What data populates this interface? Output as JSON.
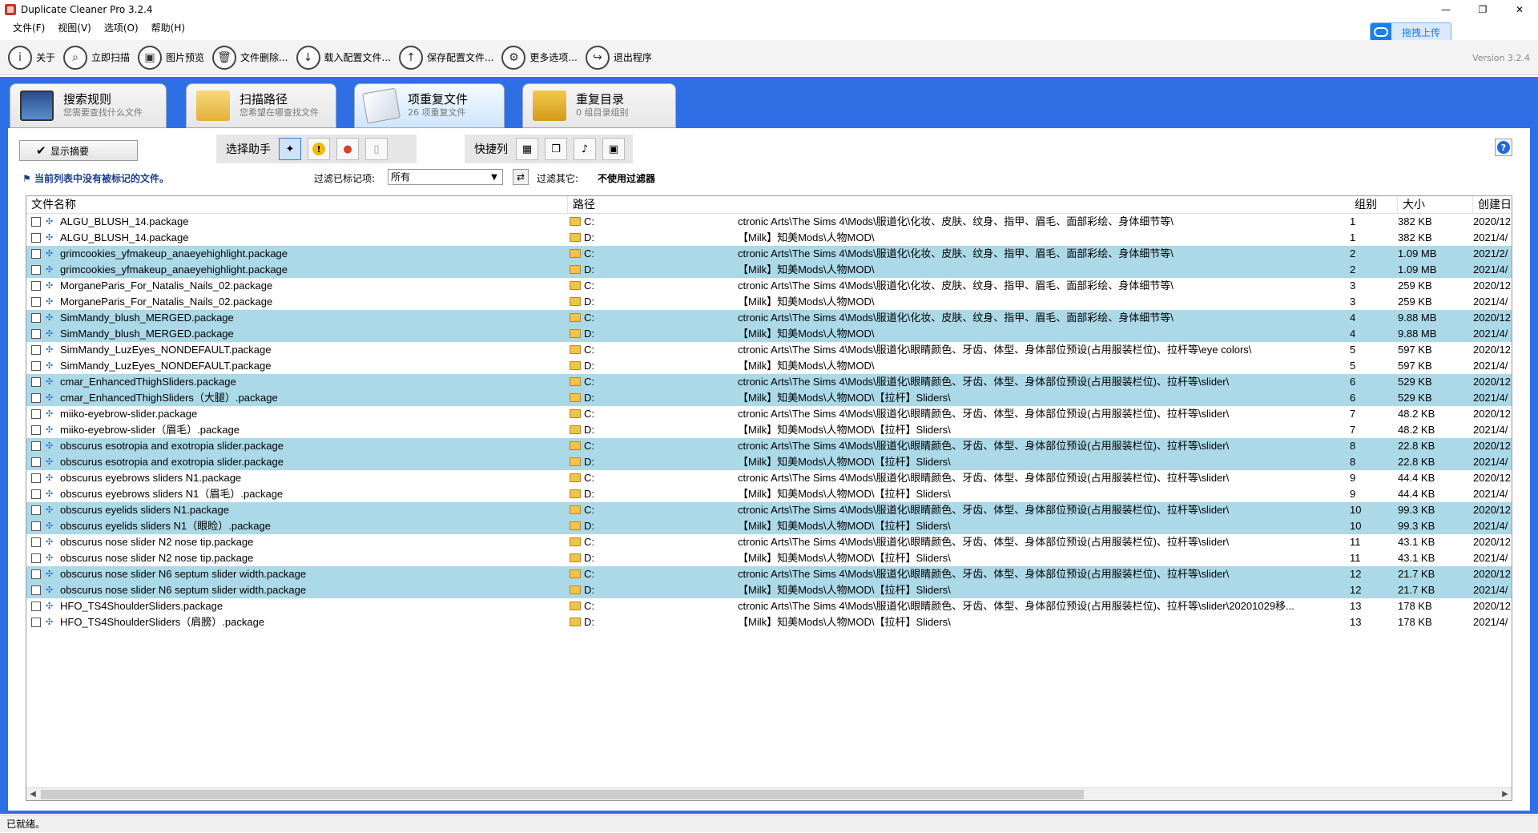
{
  "window": {
    "title": "Duplicate Cleaner Pro 3.2.4",
    "minimize": "—",
    "maximize": "❐",
    "close": "✕"
  },
  "menu": [
    "文件(F)",
    "视图(V)",
    "选项(O)",
    "帮助(H)"
  ],
  "upload_button": "拖拽上传",
  "toolbar": [
    {
      "label": "关于",
      "icon": "info-icon",
      "glyph": "i"
    },
    {
      "label": "立即扫描",
      "icon": "search-icon",
      "glyph": "⌕"
    },
    {
      "label": "图片预览",
      "icon": "image-icon",
      "glyph": "▣"
    },
    {
      "label": "文件删除...",
      "icon": "trash-icon",
      "glyph": "🗑"
    },
    {
      "label": "载入配置文件...",
      "icon": "download-icon",
      "glyph": "↓"
    },
    {
      "label": "保存配置文件...",
      "icon": "upload-icon",
      "glyph": "↑"
    },
    {
      "label": "更多选项...",
      "icon": "gear-icon",
      "glyph": "⚙"
    },
    {
      "label": "退出程序",
      "icon": "exit-icon",
      "glyph": "↪"
    }
  ],
  "version": "Version 3.2.4",
  "tabs": [
    {
      "title": "搜索规则",
      "sub": "您需要查找什么文件"
    },
    {
      "title": "扫描路径",
      "sub": "您希望在哪查找文件"
    },
    {
      "title": "项重复文件",
      "sub": "26 项重复文件"
    },
    {
      "title": "重复目录",
      "sub": "0 组目录组别"
    }
  ],
  "controls": {
    "summary_button": "显示摘要",
    "helper_label": "选择助手",
    "shortcut_label": "快捷列",
    "notice": "当前列表中没有被标记的文件。",
    "filter_label": "过滤已标记项:",
    "filter_value": "所有",
    "filter_other_label": "过滤其它:",
    "filter_other_value": "不使用过滤器"
  },
  "columns": {
    "name": "文件名称",
    "path": "路径",
    "group": "组别",
    "size": "大小",
    "created": "创建日"
  },
  "rows": [
    {
      "name": "ALGU_BLUSH_14.package",
      "drive": "C:",
      "path": "ctronic Arts\\The Sims 4\\Mods\\服道化\\化妆、皮肤、纹身、指甲、眉毛、面部彩绘、身体细节等\\",
      "group": "1",
      "size": "382 KB",
      "created": "2020/12",
      "hl": false
    },
    {
      "name": "ALGU_BLUSH_14.package",
      "drive": "D:",
      "path": "【Milk】知美Mods\\人物MOD\\",
      "group": "1",
      "size": "382 KB",
      "created": "2021/4/",
      "hl": false
    },
    {
      "name": "grimcookies_yfmakeup_anaeyehighlight.package",
      "drive": "C:",
      "path": "ctronic Arts\\The Sims 4\\Mods\\服道化\\化妆、皮肤、纹身、指甲、眉毛、面部彩绘、身体细节等\\",
      "group": "2",
      "size": "1.09 MB",
      "created": "2021/2/",
      "hl": true
    },
    {
      "name": "grimcookies_yfmakeup_anaeyehighlight.package",
      "drive": "D:",
      "path": "【Milk】知美Mods\\人物MOD\\",
      "group": "2",
      "size": "1.09 MB",
      "created": "2021/4/",
      "hl": true
    },
    {
      "name": "MorganeParis_For_Natalis_Nails_02.package",
      "drive": "C:",
      "path": "ctronic Arts\\The Sims 4\\Mods\\服道化\\化妆、皮肤、纹身、指甲、眉毛、面部彩绘、身体细节等\\",
      "group": "3",
      "size": "259 KB",
      "created": "2020/12",
      "hl": false
    },
    {
      "name": "MorganeParis_For_Natalis_Nails_02.package",
      "drive": "D:",
      "path": "【Milk】知美Mods\\人物MOD\\",
      "group": "3",
      "size": "259 KB",
      "created": "2021/4/",
      "hl": false
    },
    {
      "name": "SimMandy_blush_MERGED.package",
      "drive": "C:",
      "path": "ctronic Arts\\The Sims 4\\Mods\\服道化\\化妆、皮肤、纹身、指甲、眉毛、面部彩绘、身体细节等\\",
      "group": "4",
      "size": "9.88 MB",
      "created": "2020/12",
      "hl": true
    },
    {
      "name": "SimMandy_blush_MERGED.package",
      "drive": "D:",
      "path": "【Milk】知美Mods\\人物MOD\\",
      "group": "4",
      "size": "9.88 MB",
      "created": "2021/4/",
      "hl": true
    },
    {
      "name": "SimMandy_LuzEyes_NONDEFAULT.package",
      "drive": "C:",
      "path": "ctronic Arts\\The Sims 4\\Mods\\服道化\\眼睛颜色、牙齿、体型、身体部位预设(占用服装栏位)、拉杆等\\eye colors\\",
      "group": "5",
      "size": "597 KB",
      "created": "2020/12",
      "hl": false
    },
    {
      "name": "SimMandy_LuzEyes_NONDEFAULT.package",
      "drive": "D:",
      "path": "【Milk】知美Mods\\人物MOD\\",
      "group": "5",
      "size": "597 KB",
      "created": "2021/4/",
      "hl": false
    },
    {
      "name": "cmar_EnhancedThighSliders.package",
      "drive": "C:",
      "path": "ctronic Arts\\The Sims 4\\Mods\\服道化\\眼睛颜色、牙齿、体型、身体部位预设(占用服装栏位)、拉杆等\\slider\\",
      "group": "6",
      "size": "529 KB",
      "created": "2020/12",
      "hl": true
    },
    {
      "name": "cmar_EnhancedThighSliders（大腿）.package",
      "drive": "D:",
      "path": "【Milk】知美Mods\\人物MOD\\【拉杆】Sliders\\",
      "group": "6",
      "size": "529 KB",
      "created": "2021/4/",
      "hl": true
    },
    {
      "name": "miiko-eyebrow-slider.package",
      "drive": "C:",
      "path": "ctronic Arts\\The Sims 4\\Mods\\服道化\\眼睛颜色、牙齿、体型、身体部位预设(占用服装栏位)、拉杆等\\slider\\",
      "group": "7",
      "size": "48.2 KB",
      "created": "2020/12",
      "hl": false
    },
    {
      "name": "miiko-eyebrow-slider（眉毛）.package",
      "drive": "D:",
      "path": "【Milk】知美Mods\\人物MOD\\【拉杆】Sliders\\",
      "group": "7",
      "size": "48.2 KB",
      "created": "2021/4/",
      "hl": false
    },
    {
      "name": "obscurus esotropia and exotropia slider.package",
      "drive": "C:",
      "path": "ctronic Arts\\The Sims 4\\Mods\\服道化\\眼睛颜色、牙齿、体型、身体部位预设(占用服装栏位)、拉杆等\\slider\\",
      "group": "8",
      "size": "22.8 KB",
      "created": "2020/12",
      "hl": true
    },
    {
      "name": "obscurus esotropia and exotropia slider.package",
      "drive": "D:",
      "path": "【Milk】知美Mods\\人物MOD\\【拉杆】Sliders\\",
      "group": "8",
      "size": "22.8 KB",
      "created": "2021/4/",
      "hl": true
    },
    {
      "name": "obscurus eyebrows sliders N1.package",
      "drive": "C:",
      "path": "ctronic Arts\\The Sims 4\\Mods\\服道化\\眼睛颜色、牙齿、体型、身体部位预设(占用服装栏位)、拉杆等\\slider\\",
      "group": "9",
      "size": "44.4 KB",
      "created": "2020/12",
      "hl": false
    },
    {
      "name": "obscurus eyebrows sliders N1（眉毛）.package",
      "drive": "D:",
      "path": "【Milk】知美Mods\\人物MOD\\【拉杆】Sliders\\",
      "group": "9",
      "size": "44.4 KB",
      "created": "2021/4/",
      "hl": false
    },
    {
      "name": "obscurus eyelids sliders N1.package",
      "drive": "C:",
      "path": "ctronic Arts\\The Sims 4\\Mods\\服道化\\眼睛颜色、牙齿、体型、身体部位预设(占用服装栏位)、拉杆等\\slider\\",
      "group": "10",
      "size": "99.3 KB",
      "created": "2020/12",
      "hl": true
    },
    {
      "name": "obscurus eyelids sliders N1（眼睑）.package",
      "drive": "D:",
      "path": "【Milk】知美Mods\\人物MOD\\【拉杆】Sliders\\",
      "group": "10",
      "size": "99.3 KB",
      "created": "2021/4/",
      "hl": true
    },
    {
      "name": "obscurus nose slider N2 nose tip.package",
      "drive": "C:",
      "path": "ctronic Arts\\The Sims 4\\Mods\\服道化\\眼睛颜色、牙齿、体型、身体部位预设(占用服装栏位)、拉杆等\\slider\\",
      "group": "11",
      "size": "43.1 KB",
      "created": "2020/12",
      "hl": false
    },
    {
      "name": "obscurus nose slider N2 nose tip.package",
      "drive": "D:",
      "path": "【Milk】知美Mods\\人物MOD\\【拉杆】Sliders\\",
      "group": "11",
      "size": "43.1 KB",
      "created": "2021/4/",
      "hl": false
    },
    {
      "name": "obscurus nose slider N6 septum slider width.package",
      "drive": "C:",
      "path": "ctronic Arts\\The Sims 4\\Mods\\服道化\\眼睛颜色、牙齿、体型、身体部位预设(占用服装栏位)、拉杆等\\slider\\",
      "group": "12",
      "size": "21.7 KB",
      "created": "2020/12",
      "hl": true
    },
    {
      "name": "obscurus nose slider N6 septum slider width.package",
      "drive": "D:",
      "path": "【Milk】知美Mods\\人物MOD\\【拉杆】Sliders\\",
      "group": "12",
      "size": "21.7 KB",
      "created": "2021/4/",
      "hl": true
    },
    {
      "name": "HFO_TS4ShoulderSliders.package",
      "drive": "C:",
      "path": "ctronic Arts\\The Sims 4\\Mods\\服道化\\眼睛颜色、牙齿、体型、身体部位预设(占用服装栏位)、拉杆等\\slider\\20201029移...",
      "group": "13",
      "size": "178 KB",
      "created": "2020/12",
      "hl": false
    },
    {
      "name": "HFO_TS4ShoulderSliders（肩膀）.package",
      "drive": "D:",
      "path": "【Milk】知美Mods\\人物MOD\\【拉杆】Sliders\\",
      "group": "13",
      "size": "178 KB",
      "created": "2021/4/",
      "hl": false
    }
  ],
  "status": "已就绪。",
  "colors": {
    "frame": "#2e6fe6",
    "row_highlight": "#acd9e8"
  }
}
